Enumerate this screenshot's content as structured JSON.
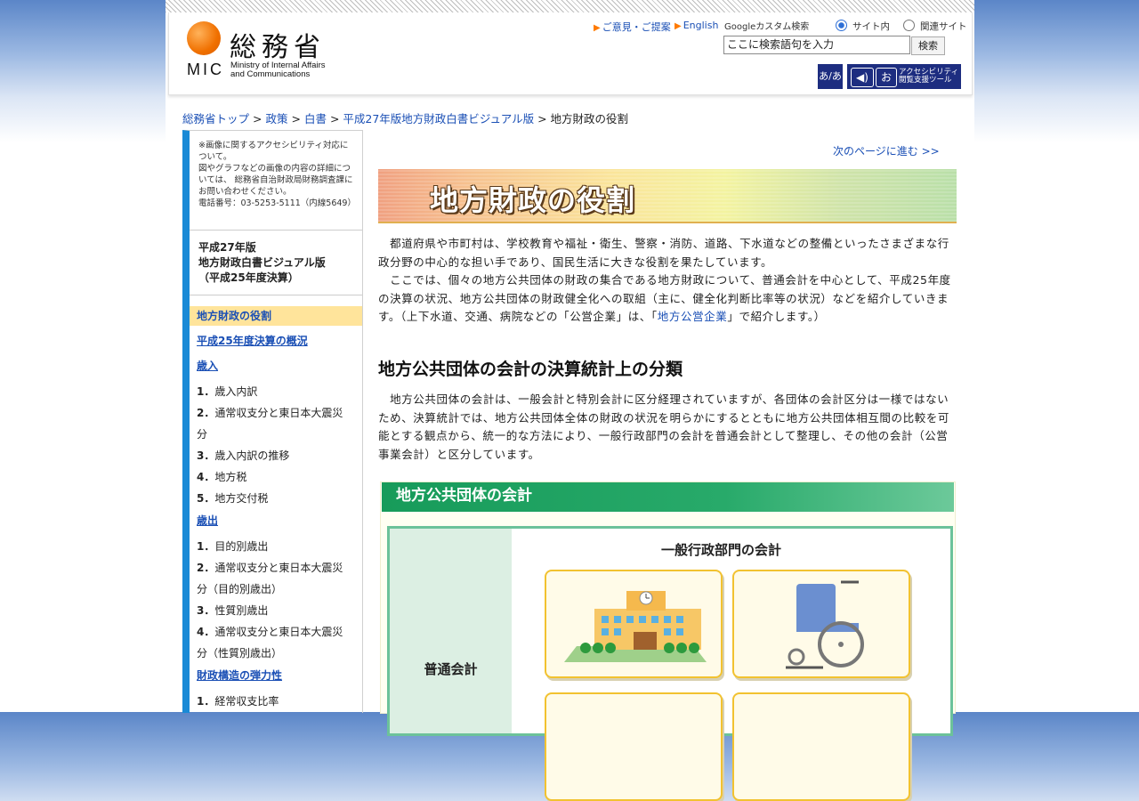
{
  "header": {
    "logo_kanji": "総務省",
    "logo_mic": "MIC",
    "logo_sub1": "Ministry of Internal Affairs",
    "logo_sub2": "and Communications",
    "link_opinion": "ご意見・ご提案",
    "link_english": "English",
    "google_img_alt": "Google",
    "google_label": "カスタム検索",
    "radio_site": "サイト内",
    "radio_related": "関連サイト",
    "search_value": "ここに検索語句を入力",
    "search_button": "検索",
    "acc_font_label": "あ/あ",
    "acc_tool_label1": "アクセシビリティ",
    "acc_tool_label2": "閲覧支援ツール"
  },
  "breadcrumb": {
    "items": [
      "総務省トップ",
      "政策",
      "白書",
      "平成27年版地方財政白書ビジュアル版"
    ],
    "current": "地方財政の役割",
    "sep": ">"
  },
  "sidebar": {
    "note": "※画像に関するアクセシビリティ対応について。\n図やグラフなどの画像の内容の詳細については、 総務省自治財政局財務調査課にお問い合わせください。\n電話番号：03-5253-5111（内線5649）",
    "book_title_1": "平成27年版",
    "book_title_2": "地方財政白書ビジュアル版",
    "book_title_3": "（平成25年度決算）",
    "sections": [
      {
        "label": "地方財政の役割",
        "active": true,
        "items": []
      },
      {
        "label": "平成25年度決算の概況",
        "active": false,
        "items": []
      },
      {
        "label": "歳入",
        "active": false,
        "items": [
          {
            "num": "1．",
            "label": "歳入内訳"
          },
          {
            "num": "2．",
            "label": "通常収支分と東日本大震災分"
          },
          {
            "num": "3．",
            "label": "歳入内訳の推移"
          },
          {
            "num": "4．",
            "label": "地方税"
          },
          {
            "num": "5．",
            "label": "地方交付税"
          }
        ]
      },
      {
        "label": "歳出",
        "active": false,
        "items": [
          {
            "num": "1．",
            "label": "目的別歳出"
          },
          {
            "num": "2．",
            "label": "通常収支分と東日本大震災分（目的別歳出）"
          },
          {
            "num": "3．",
            "label": "性質別歳出"
          },
          {
            "num": "4．",
            "label": "通常収支分と東日本大震災分（性質別歳出）"
          }
        ]
      },
      {
        "label": "財政構造の弾力性",
        "active": false,
        "items": [
          {
            "num": "1．",
            "label": "経常収支比率"
          }
        ]
      }
    ]
  },
  "main": {
    "next_page": "次のページに進む >>",
    "banner_title": "地方財政の役割",
    "para1_a": "　都道府県や市町村は、学校教育や福祉・衛生、警察・消防、道路、下水道などの整備といったさまざまな行政分野の中心的な担い手であり、国民生活に大きな役割を果たしています。",
    "para1_b": "　ここでは、個々の地方公共団体の財政の集合である地方財政について、普通会計を中心として、平成25年度の決算の状況、地方公共団体の財政健全化への取組（主に、健全化判断比率等の状況）などを紹介していきます。（上下水道、交通、病院などの「公営企業」は、「",
    "para1_link": "地方公営企業",
    "para1_c": "」で紹介します。）",
    "h2": "地方公共団体の会計の決算統計上の分類",
    "para2": "　地方公共団体の会計は、一般会計と特別会計に区分経理されていますが、各団体の会計区分は一様ではないため、決算統計では、地方公共団体全体の財政の状況を明らかにするとともに地方公共団体相互間の比較を可能とする観点から、統一的な方法により、一般行政部門の会計を普通会計として整理し、その他の会計（公営事業会計）と区分しています。",
    "diagram_title": "地方公共団体の会計",
    "diagram_left": "普通会計",
    "diagram_sub": "一般行政部門の会計"
  },
  "colors": {
    "link": "#1a4fb5",
    "sidebar_accent": "#1a8ad6",
    "active_nav": "#ffe49b",
    "diagram_green": "#179b5a",
    "card_border": "#f2c230"
  }
}
